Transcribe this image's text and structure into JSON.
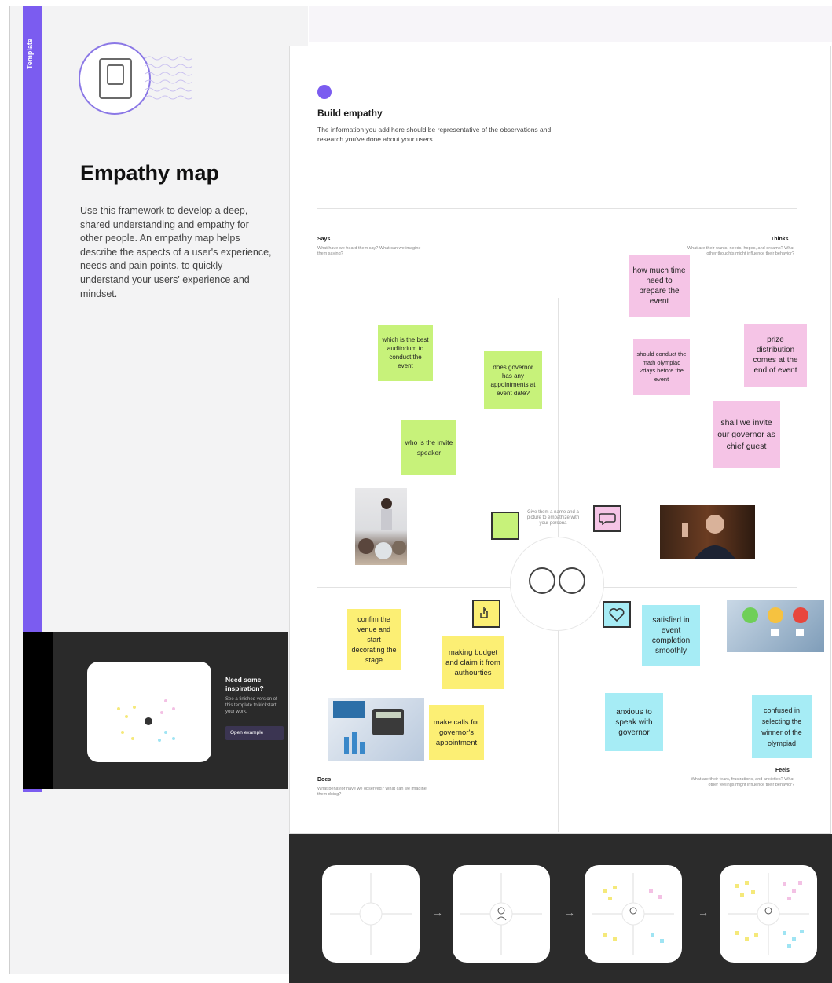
{
  "sidebar": {
    "tag": "Template",
    "title": "Empathy map",
    "description": "Use this framework to develop a deep, shared understanding and empathy for other people. An empathy map helps describe the aspects of a user's experience, needs and pain points, to quickly understand your users' experience and mindset.",
    "inspiration": {
      "heading": "Need some inspiration?",
      "sub": "See a finished version of this template to kickstart your work.",
      "button": "Open example"
    }
  },
  "board": {
    "heading": "Build empathy",
    "description": "The information you add here should be representative of the observations and research you've done about your users.",
    "says": {
      "label": "Says",
      "sub": "What have we heard them say? What can we imagine them saying?"
    },
    "thinks": {
      "label": "Thinks",
      "sub": "What are their wants, needs, hopes, and dreams? What other thoughts might influence their behavior?"
    },
    "does": {
      "label": "Does",
      "sub": "What behavior have we observed? What can we imagine them doing?"
    },
    "feels": {
      "label": "Feels",
      "sub": "What are their fears, frustrations, and anxieties? What other feelings might influence their behavior?"
    },
    "center_hint": "Give them a name and a picture to empathize with your persona",
    "stickies": {
      "s1": "which is the best auditorium to conduct the event",
      "s2": "does governor has any appointments at event date?",
      "s3": "who is the invite speaker",
      "t1": "how much time need to prepare the event",
      "t2": "prize distribution comes at the end of event",
      "t3": "should conduct the math olympiad 2days before the event",
      "t4": "shall we invite our governor as chief guest",
      "d1": "confim the venue and start decorating the stage",
      "d2": "making budget and claim it from authourties",
      "d3": "make calls for governor's appointment",
      "f1": "satisfied in event completion smoothly",
      "f2": "anxious to speak with governor",
      "f3": "confused in selecting the winner of the olympiad"
    }
  },
  "colors": {
    "accent": "#7b5cf0",
    "green": "#c7f27a",
    "pink": "#f5c4e6",
    "yellow": "#fcef74",
    "blue": "#a6ecf5"
  }
}
